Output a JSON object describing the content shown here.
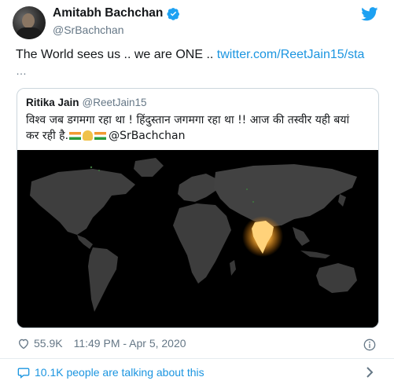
{
  "author": {
    "display_name": "Amitabh Bachchan",
    "handle": "@SrBachchan",
    "verified_icon": "verified-badge-icon",
    "brand_icon": "twitter-bird-icon"
  },
  "tweet": {
    "text_prefix": "The World sees us .. we are ONE .. ",
    "link": "twitter.com/ReetJain15/sta",
    "ellipsis": "…"
  },
  "quoted_tweet": {
    "display_name": "Ritika Jain",
    "handle": "@ReetJain15",
    "text_line1": "विश्व जब डगमगा रहा था ! हिंदुस्तान जगमगा रहा था !! आज की तस्वीर यही बयां",
    "text_line2": "कर रही है.",
    "mention": "@SrBachchan",
    "emojis": [
      "india-flag-icon",
      "folded-hands-icon",
      "india-flag-icon"
    ],
    "image": "world-map-night-india-lit"
  },
  "meta": {
    "likes": "55.9K",
    "timestamp": "11:49 PM - Apr 5, 2020",
    "like_icon": "heart-icon",
    "info_icon": "info-icon"
  },
  "conversation": {
    "label": "10.1K people are talking about this",
    "icon": "comment-bubble-icon",
    "chevron": "chevron-right-icon"
  },
  "colors": {
    "link": "#1b95e0",
    "secondary_text": "#657786",
    "border": "#ccd6dd",
    "map_land": "#3f3f3f",
    "map_glow": "#ffb23a"
  }
}
